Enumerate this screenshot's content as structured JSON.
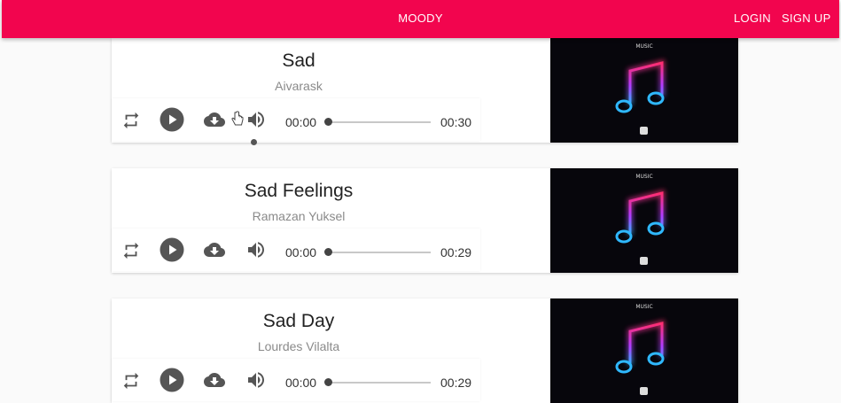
{
  "header": {
    "brand": "MOODY",
    "login": "LOGIN",
    "signup": "SIGN UP",
    "color": "#f2054e"
  },
  "icons": {
    "repeat": "repeat-icon",
    "play": "play-icon",
    "download": "cloud-download-icon",
    "volume": "volume-icon",
    "cover": "music-note-icon"
  },
  "songs": [
    {
      "title": "Sad",
      "artist": "Aivarask",
      "current": "00:00",
      "duration": "00:30",
      "cover_label": "MUSIC",
      "progress": 0
    },
    {
      "title": "Sad Feelings",
      "artist": "Ramazan Yuksel",
      "current": "00:00",
      "duration": "00:29",
      "cover_label": "MUSIC",
      "progress": 0
    },
    {
      "title": "Sad Day",
      "artist": "Lourdes Vilalta",
      "current": "00:00",
      "duration": "00:29",
      "cover_label": "MUSIC",
      "progress": 0
    }
  ]
}
